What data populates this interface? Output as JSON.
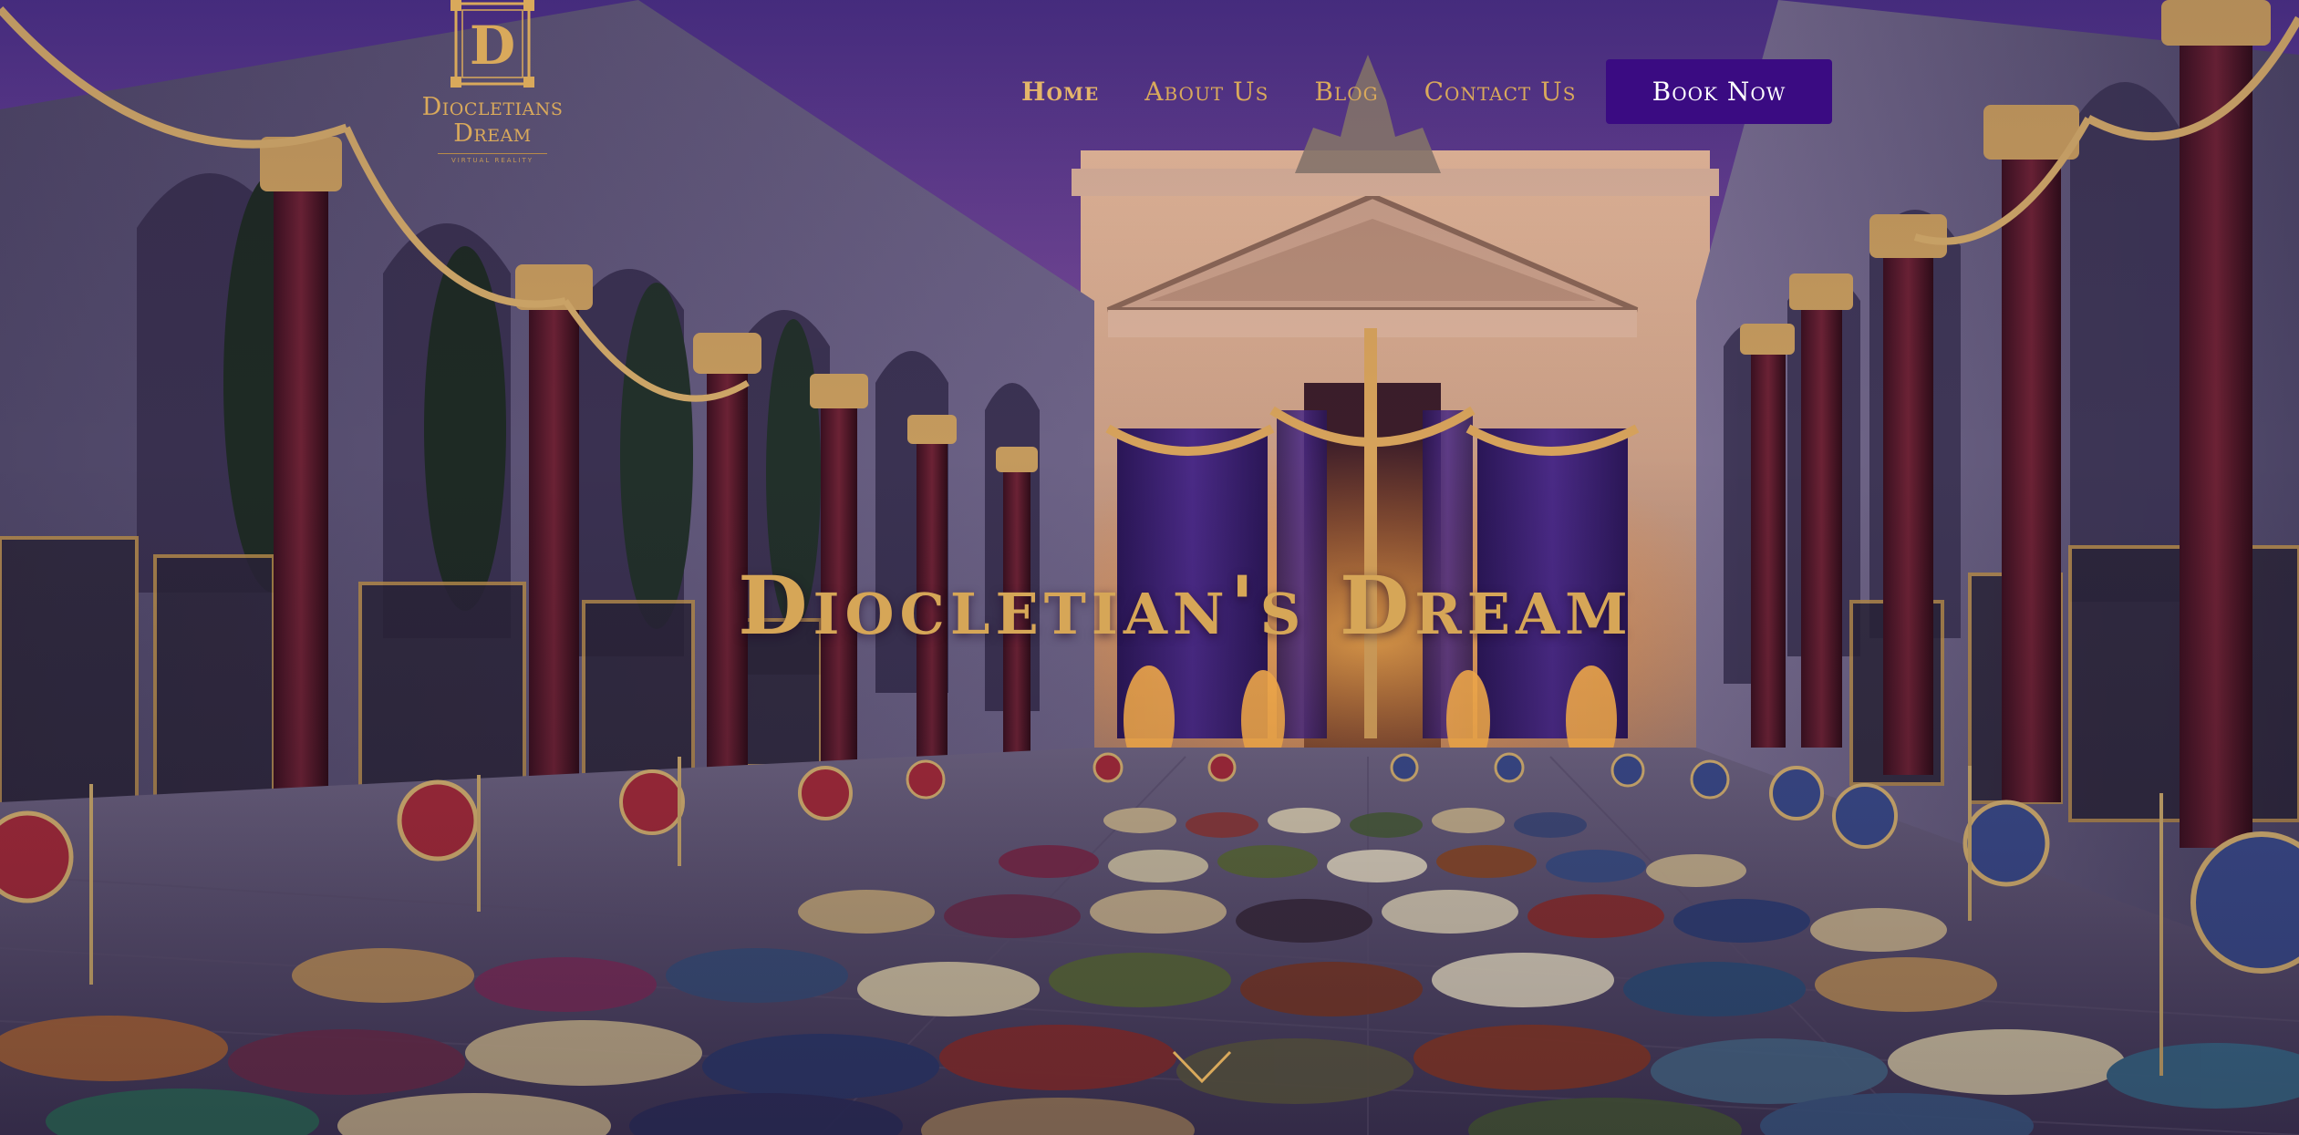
{
  "brand": {
    "monogram": "D",
    "name_line1": "Diocletians",
    "name_line2": "Dream",
    "tagline": "VIRTUAL REALITY"
  },
  "nav": {
    "items": [
      {
        "label": "Home",
        "active": true
      },
      {
        "label": "About Us",
        "active": false
      },
      {
        "label": "Blog",
        "active": false
      },
      {
        "label": "Contact Us",
        "active": false
      }
    ],
    "cta_label": "Book Now"
  },
  "hero": {
    "title": "Diocletian's Dream",
    "scroll_icon": "chevron-down-icon"
  },
  "colors": {
    "gold": "#d9a95b",
    "cta_background": "#3a0b82",
    "cta_text": "#ffffff"
  }
}
